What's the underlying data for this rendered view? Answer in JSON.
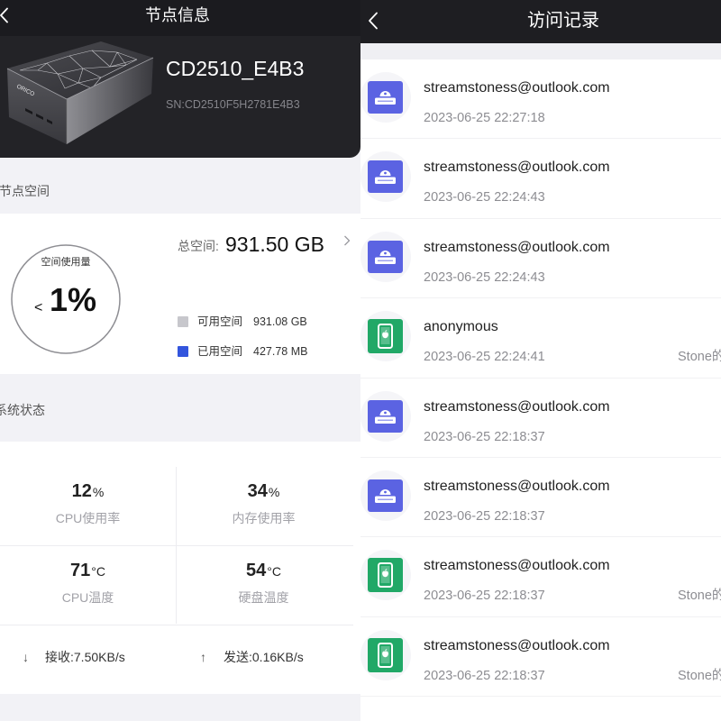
{
  "left": {
    "header": {
      "title": "节点信息",
      "back_icon": "chevron-left-icon"
    },
    "device": {
      "name": "CD2510_E4B3",
      "sn": "SN:CD2510F5H2781E4B3",
      "logo_text": "ORICO",
      "image_icon": "device-image"
    },
    "space": {
      "section_title": "节点空间",
      "gauge_label": "空间使用量",
      "usage_prefix": "<",
      "usage_value": "1%",
      "total_label": "总空间:",
      "total_value": "931.50 GB",
      "detail_icon": "chevron-right-icon",
      "legend": [
        {
          "label": "可用空间",
          "value": "931.08 GB",
          "color": "#c7c7cc"
        },
        {
          "label": "已用空间",
          "value": "427.78 MB",
          "color": "#3355dd"
        }
      ]
    },
    "system": {
      "section_title": "系统状态",
      "stats": [
        {
          "value": "12",
          "unit": "%",
          "label": "CPU使用率"
        },
        {
          "value": "34",
          "unit": "%",
          "label": "内存使用率"
        },
        {
          "value": "71",
          "unit": "°C",
          "label": "CPU温度"
        },
        {
          "value": "54",
          "unit": "°C",
          "label": "硬盘温度"
        }
      ],
      "network": [
        {
          "arrow": "↓",
          "text": "接收:7.50KB/s"
        },
        {
          "arrow": "↑",
          "text": "发送:0.16KB/s"
        }
      ]
    }
  },
  "right": {
    "header": {
      "title": "访问记录",
      "back_icon": "chevron-left-icon"
    },
    "records": [
      {
        "icon": "drive-icon",
        "user": "streamstoness@outlook.com",
        "time": "2023-06-25 22:27:18"
      },
      {
        "icon": "drive-icon",
        "user": "streamstoness@outlook.com",
        "time": "2023-06-25 22:24:43"
      },
      {
        "icon": "drive-icon",
        "user": "streamstoness@outlook.com",
        "time": "2023-06-25 22:24:43"
      },
      {
        "icon": "phone-icon",
        "user": "anonymous",
        "time": "2023-06-25 22:24:41",
        "device": "Stone的"
      },
      {
        "icon": "drive-icon",
        "user": "streamstoness@outlook.com",
        "time": "2023-06-25 22:18:37"
      },
      {
        "icon": "drive-icon",
        "user": "streamstoness@outlook.com",
        "time": "2023-06-25 22:18:37"
      },
      {
        "icon": "phone-icon",
        "user": "streamstoness@outlook.com",
        "time": "2023-06-25 22:18:37",
        "device": "Stone的"
      },
      {
        "icon": "phone-icon",
        "user": "streamstoness@outlook.com",
        "time": "2023-06-25 22:18:37",
        "device": "Stone的"
      }
    ]
  },
  "colors": {
    "header_bg": "#1c1c20",
    "page_bg": "#f2f2f6",
    "drive-icon": "#5b63e2",
    "phone-icon": "#21a867",
    "used_space": "#3355dd",
    "free_space": "#c7c7cc"
  }
}
